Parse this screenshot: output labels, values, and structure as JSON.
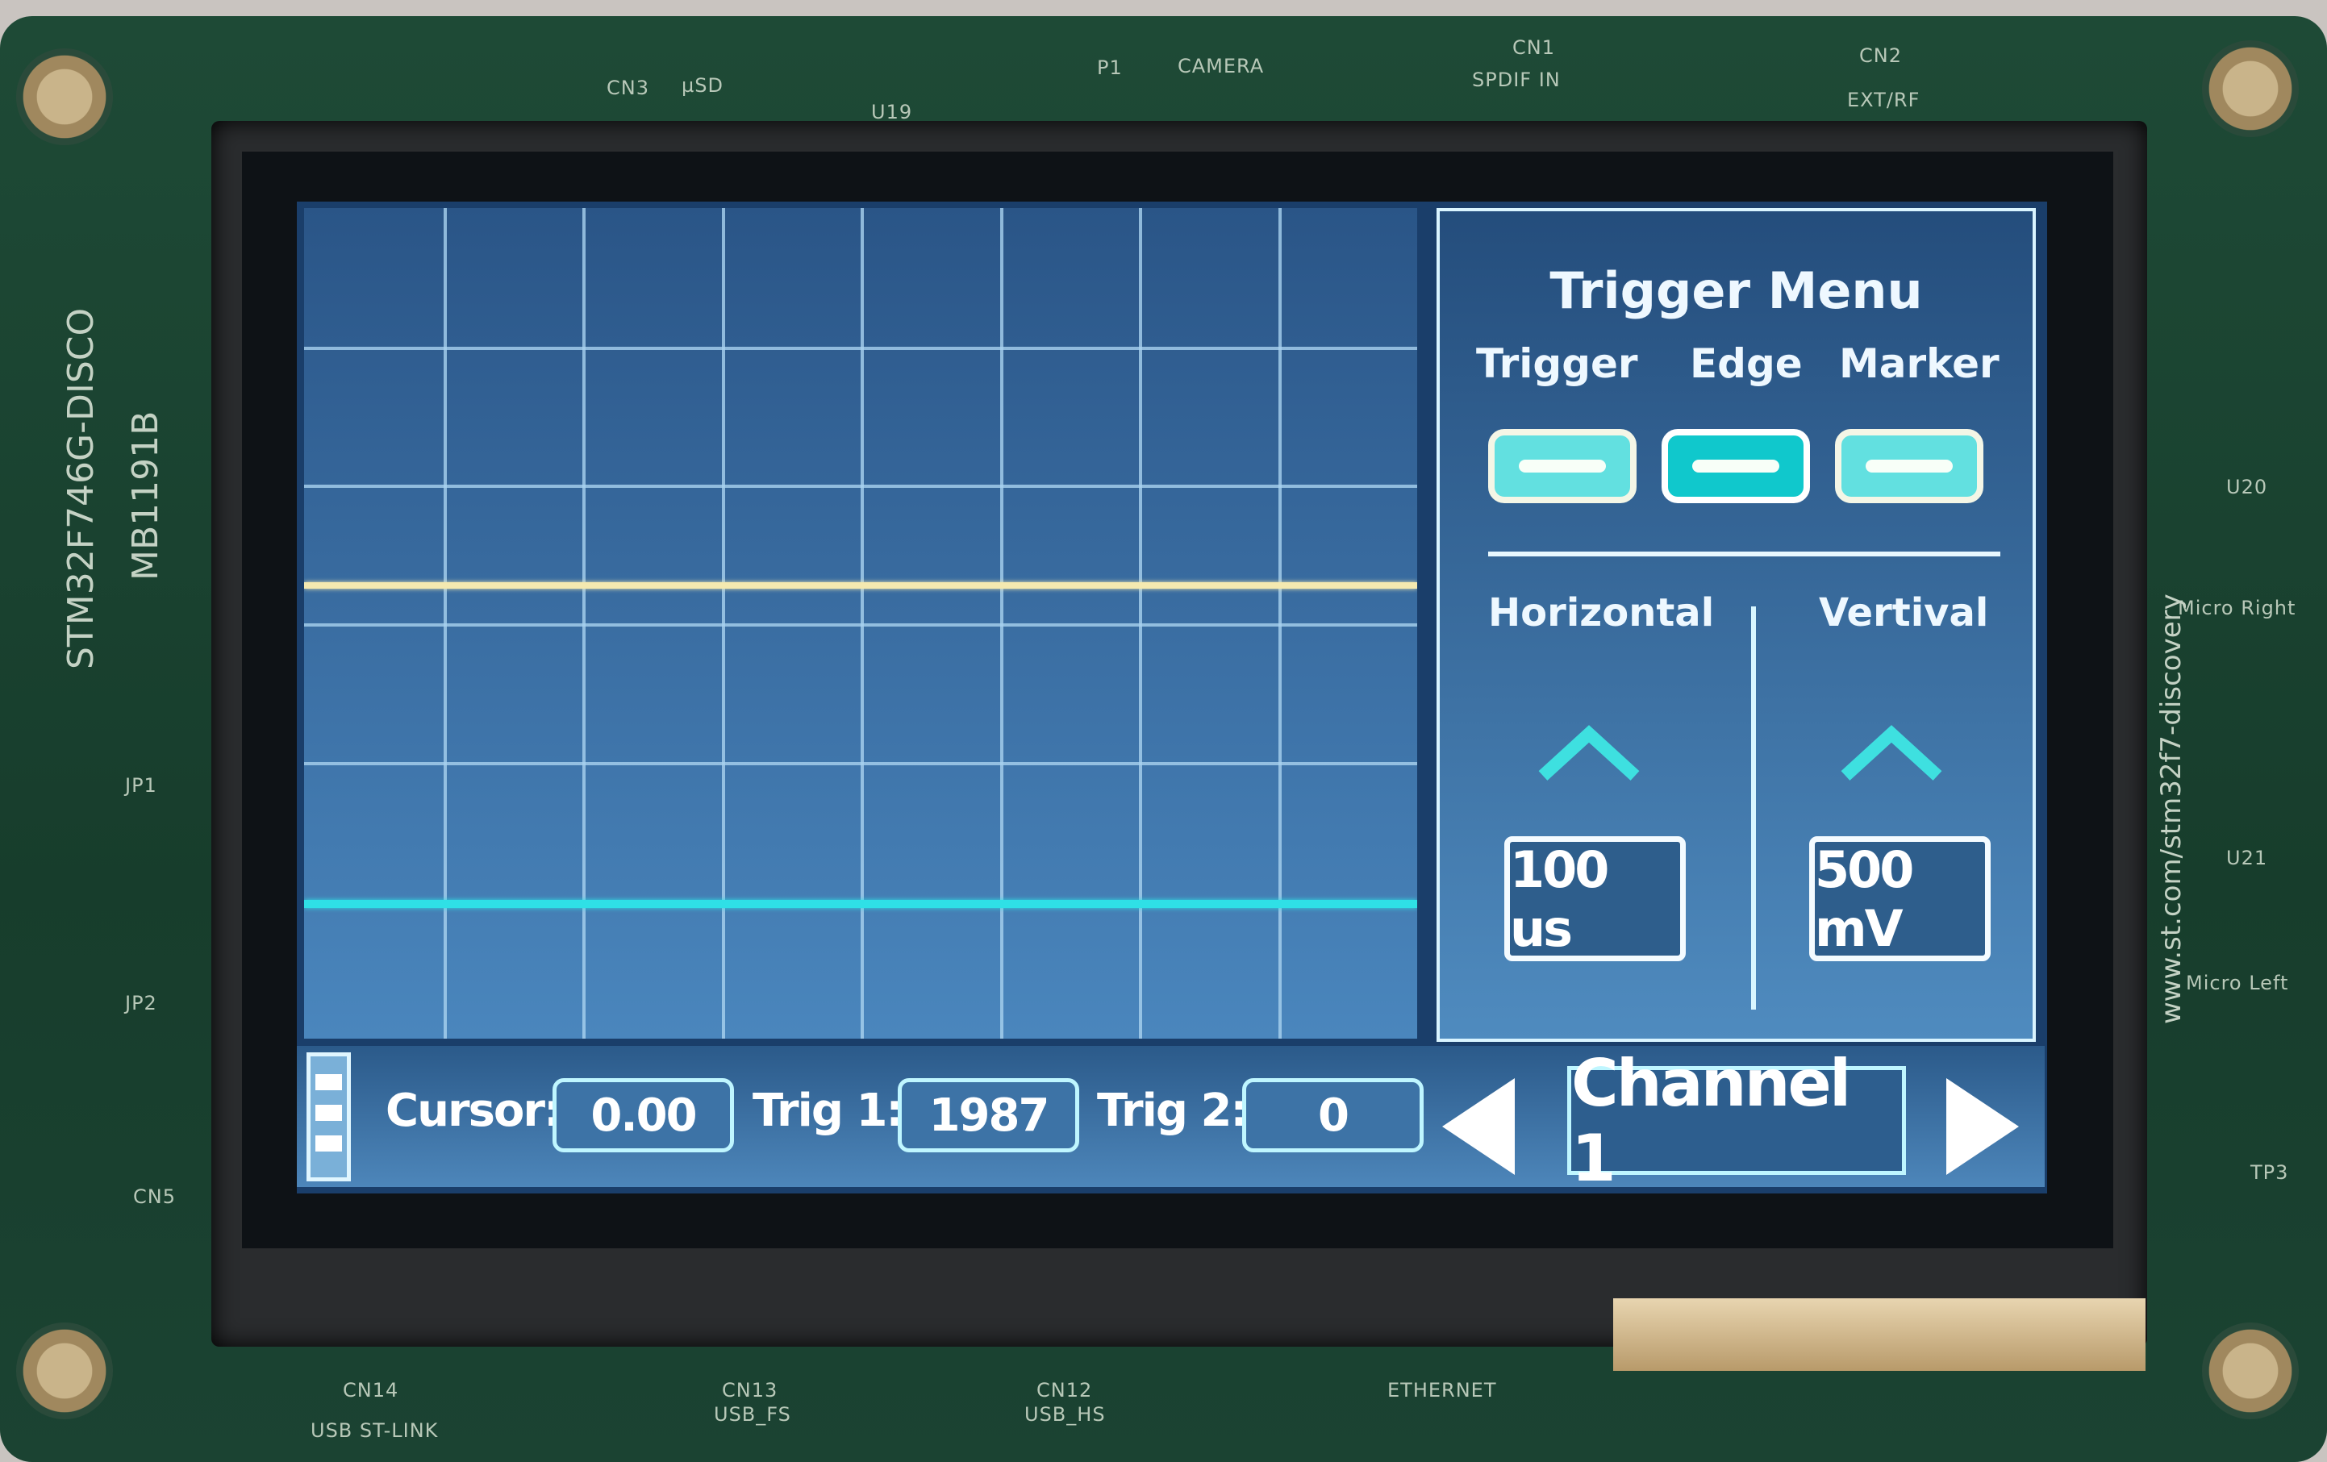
{
  "board": {
    "name": "STM32F746G-DISCO",
    "revision": "MB1191B",
    "url": "www.st.com/stm32f7-discovery",
    "silkscreen": [
      "CN3",
      "µSD",
      "U19",
      "P1",
      "CAMERA",
      "CN1",
      "SPDIF IN",
      "CN2",
      "EXT/RF",
      "CN14",
      "USB ST-LINK",
      "CN13",
      "USB_FS",
      "CN12",
      "USB_HS",
      "ETHERNET",
      "JP1",
      "JP2",
      "CN5",
      "U20",
      "Micro Right",
      "U21",
      "Micro Left",
      "TP3"
    ]
  },
  "scope": {
    "grid": {
      "columns": 8,
      "rows": 6
    },
    "traces": [
      {
        "color": "#f4e9b0",
        "level_divisions_from_top": 2.7
      },
      {
        "color": "#2fe0e6",
        "level_divisions_from_top": 5.0
      }
    ]
  },
  "trigger_menu": {
    "title": "Trigger Menu",
    "toggles": [
      {
        "label": "Trigger",
        "active": false
      },
      {
        "label": "Edge",
        "active": true
      },
      {
        "label": "Marker",
        "active": false
      }
    ],
    "horizontal": {
      "label": "Horizontal",
      "value": "100 us"
    },
    "vertical": {
      "label": "Vertival",
      "value": "500 mV"
    }
  },
  "bottom_bar": {
    "cursor_label": "Cursor:",
    "cursor_value": "0.00",
    "trig1_label": "Trig 1:",
    "trig1_value": "1987",
    "trig2_label": "Trig 2:",
    "trig2_value": "0",
    "channel": "Channel 1"
  },
  "colors": {
    "accent": "#62e0e0",
    "screen_bg": "#2a5587",
    "pcb": "#1e4a36"
  }
}
